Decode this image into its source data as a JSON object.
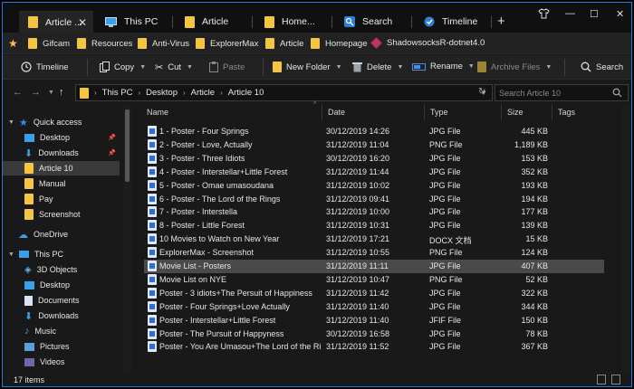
{
  "tabs": [
    {
      "label": "Article ...",
      "icon": "folder-icon",
      "active": true
    },
    {
      "label": "This PC",
      "icon": "computer-icon"
    },
    {
      "label": "Article",
      "icon": "folder-icon"
    },
    {
      "label": "Home...",
      "icon": "folder-icon"
    },
    {
      "label": "Search",
      "icon": "search-app-icon"
    },
    {
      "label": "Timeline",
      "icon": "timeline-icon"
    }
  ],
  "favorites": [
    "Gifcam",
    "Resources",
    "Anti-Virus",
    "ExplorerMax",
    "Article",
    "Homepage",
    "ShadowsocksR-dotnet4.0"
  ],
  "commands": {
    "timeline": "Timeline",
    "copy": "Copy",
    "cut": "Cut",
    "paste": "Paste",
    "new_folder": "New Folder",
    "delete": "Delete",
    "rename": "Rename",
    "archive": "Archive Files",
    "search": "Search"
  },
  "address": {
    "crumbs": [
      "This PC",
      "Desktop",
      "Article",
      "Article 10"
    ],
    "search_placeholder": "Search Article 10"
  },
  "sidebar": [
    {
      "label": "Quick access",
      "icon": "star-icon",
      "expand": true
    },
    {
      "label": "Desktop",
      "icon": "desktop-icon",
      "pinned": true
    },
    {
      "label": "Downloads",
      "icon": "download-icon",
      "pinned": true
    },
    {
      "label": "Article 10",
      "icon": "folder-icon",
      "selected": true
    },
    {
      "label": "Manual",
      "icon": "folder-icon"
    },
    {
      "label": "Pay",
      "icon": "folder-icon"
    },
    {
      "label": "Screenshot",
      "icon": "folder-icon"
    },
    {
      "label": "OneDrive",
      "icon": "cloud-icon",
      "expand": true
    },
    {
      "label": "This PC",
      "icon": "computer-icon",
      "expand": true
    },
    {
      "label": "3D Objects",
      "icon": "cube-icon"
    },
    {
      "label": "Desktop",
      "icon": "desktop-icon"
    },
    {
      "label": "Documents",
      "icon": "documents-icon"
    },
    {
      "label": "Downloads",
      "icon": "download-icon"
    },
    {
      "label": "Music",
      "icon": "music-icon"
    },
    {
      "label": "Pictures",
      "icon": "pictures-icon"
    },
    {
      "label": "Videos",
      "icon": "videos-icon"
    }
  ],
  "columns": {
    "name": "Name",
    "date": "Date",
    "type": "Type",
    "size": "Size",
    "tags": "Tags"
  },
  "files": [
    {
      "name": "1 - Poster - Four Springs",
      "date": "30/12/2019 14:26",
      "type": "JPG File",
      "size": "445 KB"
    },
    {
      "name": "2 - Poster - Love, Actually",
      "date": "31/12/2019 11:04",
      "type": "PNG File",
      "size": "1,189 KB"
    },
    {
      "name": "3 - Poster - Three Idiots",
      "date": "30/12/2019 16:20",
      "type": "JPG File",
      "size": "153 KB"
    },
    {
      "name": "4 - Poster - Interstellar+Little Forest",
      "date": "31/12/2019 11:44",
      "type": "JPG File",
      "size": "352 KB"
    },
    {
      "name": "5 - Poster - Omae umasoudana",
      "date": "31/12/2019 10:02",
      "type": "JPG File",
      "size": "193 KB"
    },
    {
      "name": "6 - Poster - The Lord of the Rings",
      "date": "31/12/2019 09:41",
      "type": "JPG File",
      "size": "194 KB"
    },
    {
      "name": "7 - Poster - Interstella",
      "date": "31/12/2019 10:00",
      "type": "JPG File",
      "size": "177 KB"
    },
    {
      "name": "8 - Poster - Little Forest",
      "date": "31/12/2019 10:31",
      "type": "JPG File",
      "size": "139 KB"
    },
    {
      "name": "10 Movies to Watch on New Year",
      "date": "31/12/2019 17:21",
      "type": "DOCX 文档",
      "size": "15 KB"
    },
    {
      "name": "ExplorerMax - Screenshot",
      "date": "31/12/2019 10:55",
      "type": "PNG File",
      "size": "124 KB"
    },
    {
      "name": "Movie List - Posters",
      "date": "31/12/2019 11:11",
      "type": "JPG File",
      "size": "407 KB",
      "selected": true
    },
    {
      "name": "Movie List on NYE",
      "date": "31/12/2019 10:47",
      "type": "PNG File",
      "size": "52 KB"
    },
    {
      "name": "Poster - 3 idiots+The Persuit of Happiness",
      "date": "31/12/2019 11:42",
      "type": "JPG File",
      "size": "322 KB"
    },
    {
      "name": "Poster - Four Springs+Love Actually",
      "date": "31/12/2019 11:40",
      "type": "JPG File",
      "size": "344 KB"
    },
    {
      "name": "Poster - Interstellar+Little Forest",
      "date": "31/12/2019 11:40",
      "type": "JFIF File",
      "size": "150 KB"
    },
    {
      "name": "Poster - The Pursuit of Happyness",
      "date": "30/12/2019 16:58",
      "type": "JPG File",
      "size": "78 KB"
    },
    {
      "name": "Poster - You Are Umasou+The Lord of the Ri...",
      "date": "31/12/2019 11:52",
      "type": "JPG File",
      "size": "367 KB"
    }
  ],
  "status": "17 items",
  "colors": {
    "accent": "#1e7be0",
    "folder": "#f4c542",
    "background": "#191919"
  }
}
